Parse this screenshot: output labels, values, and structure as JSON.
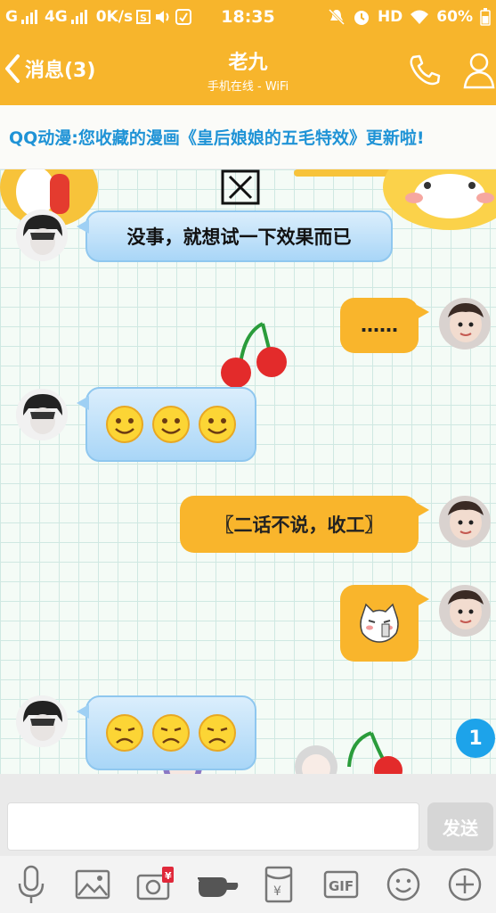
{
  "status_bar": {
    "left_net": "G",
    "net_4g": "4G",
    "speed": "0K/s",
    "time": "18:35",
    "hd": "HD",
    "battery": "60%"
  },
  "header": {
    "back_label": "消息(3)",
    "title": "老九",
    "subtitle": "手机在线 - WiFi"
  },
  "banner": {
    "text": "QQ动漫:您收藏的漫画《皇后娘娘的五毛特效》更新啦!"
  },
  "messages": [
    {
      "side": "left",
      "text": "没事，就想试一下效果而已"
    },
    {
      "side": "right",
      "text": "……"
    },
    {
      "side": "left",
      "emojis": [
        "smile",
        "smile",
        "smile"
      ]
    },
    {
      "side": "right",
      "text": "〖二话不说，收工〗"
    },
    {
      "side": "right",
      "sticker": "cat-sticker"
    },
    {
      "side": "left",
      "emojis": [
        "sad",
        "sad",
        "sad"
      ]
    }
  ],
  "unread_count": "1",
  "input": {
    "send_label": "发送",
    "placeholder": ""
  },
  "toolbar": {
    "items": [
      "mic-icon",
      "image-icon",
      "camera-icon",
      "poke-icon",
      "red-packet-icon",
      "gif-icon",
      "emoji-icon",
      "plus-icon"
    ],
    "gif_label": "GIF",
    "red_packet_label": "¥"
  },
  "colors": {
    "brand": "#f7b52c",
    "bubble_blue": "#a9d6f7",
    "bubble_orange": "#f9b52c",
    "link_blue": "#1f93d6",
    "badge": "#1da3ea"
  }
}
